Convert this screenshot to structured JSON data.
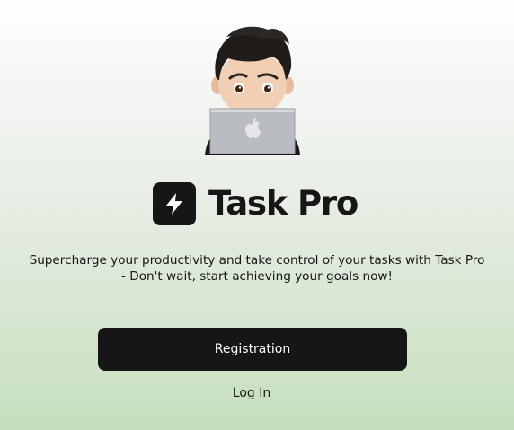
{
  "app": {
    "title": "Task Pro"
  },
  "hero": {
    "avatar_icon": "memoji-laptop-illustration",
    "logo_icon": "lightning-bolt-icon"
  },
  "intro": {
    "tagline": "Supercharge your productivity and take control of your tasks with Task Pro - Don't wait, start achieving your goals now!"
  },
  "actions": {
    "register_label": "Registration",
    "login_label": "Log In"
  },
  "colors": {
    "primary": "#161616",
    "background_top": "#ffffff",
    "background_bottom": "#c5dfbd",
    "button_text": "#ffffff"
  }
}
